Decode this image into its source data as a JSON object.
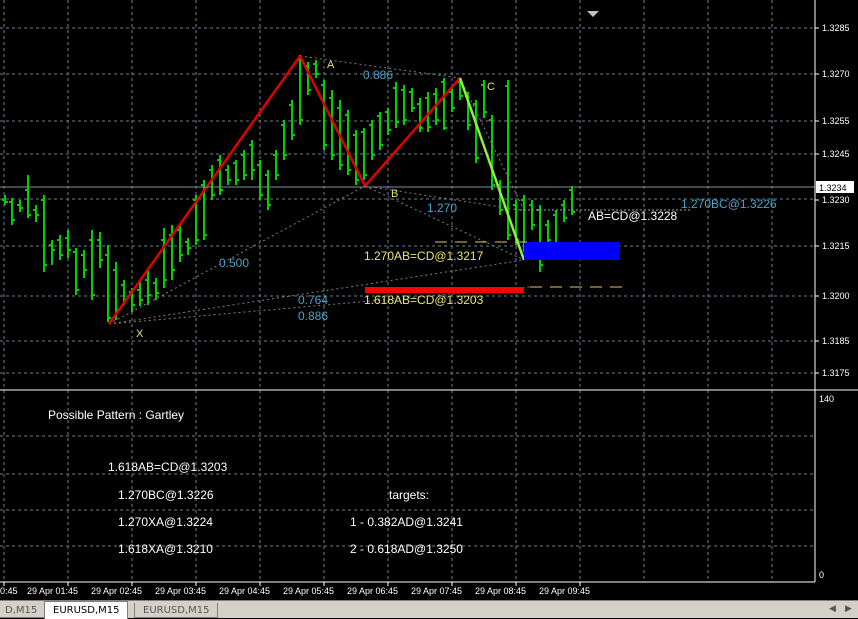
{
  "tabs": [
    {
      "label": "D,M15",
      "active": false
    },
    {
      "label": "EURUSD,M15",
      "active": true
    },
    {
      "label": "EURUSD,M15",
      "active": false
    }
  ],
  "price_axis": {
    "labels": [
      "1.3285",
      "1.3270",
      "1.3255",
      "1.3245",
      "1.3230",
      "1.3215",
      "1.3200",
      "1.3185",
      "1.3175"
    ],
    "current_price": "1.3234"
  },
  "indicator_axis": {
    "labels": [
      "140",
      "0"
    ]
  },
  "time_axis": {
    "labels": [
      "0:45",
      "29 Apr 01:45",
      "29 Apr 02:45",
      "29 Apr 03:45",
      "29 Apr 04:45",
      "29 Apr 05:45",
      "29 Apr 06:45",
      "29 Apr 07:45",
      "29 Apr 08:45",
      "29 Apr 09:45"
    ]
  },
  "pattern_points": {
    "X": "X",
    "A": "A",
    "B": "B",
    "C": "C"
  },
  "chart_annotations": {
    "ratio_xb": "0.500",
    "ratio_ac": "0.886",
    "ratio_bc": "1.270",
    "ratio_xd1": "0.764",
    "ratio_xd2": "0.886",
    "bc_ext": "1.270BC@1.3226",
    "abcd": "AB=CD@1.3228",
    "abcd_1270": "1.270AB=CD@1.3217",
    "abcd_1618": "1.618AB=CD@1.3203"
  },
  "info_panel": {
    "title": "Possible Pattern : Gartley",
    "lines_left": [
      "1.618AB=CD@1.3203",
      "1.270BC@1.3226",
      "1.270XA@1.3224",
      "1.618XA@1.3210"
    ],
    "targets_title": "targets:",
    "targets": [
      "1 - 0.382AD@1.3241",
      "2 - 0.618AD@1.3250"
    ]
  },
  "colors": {
    "background": "#000000",
    "grid": "#6b7b8c",
    "candle": "#00d000",
    "xabc_leg": "#e00000",
    "cd_leg": "#90ee40",
    "fib_text": "#4aa3c7",
    "label_text": "#e8e47a",
    "target_box": "#0000ff",
    "stop_bar": "#ff0000"
  }
}
